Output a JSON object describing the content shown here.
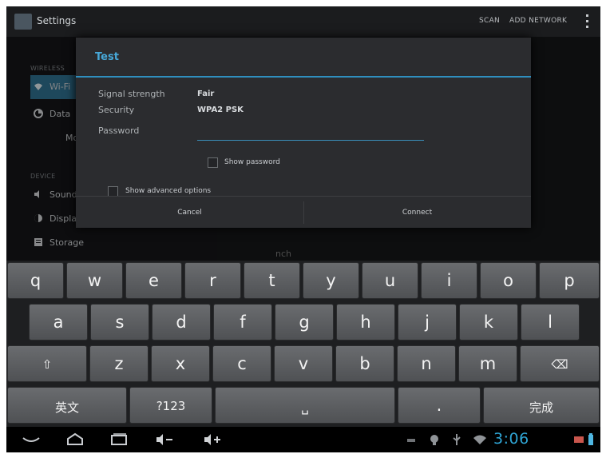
{
  "action_bar": {
    "title": "Settings",
    "actions": [
      "SCAN",
      "ADD NETWORK"
    ]
  },
  "settings_bg": {
    "categories": [
      "WIRELESS",
      "DEVICE"
    ],
    "items": [
      "Wi-Fi",
      "Data",
      "More",
      "Sound",
      "Display",
      "Storage"
    ],
    "right_fragment": "nch"
  },
  "dialog": {
    "title": "Test",
    "signal_label": "Signal strength",
    "signal_value": "Fair",
    "security_label": "Security",
    "security_value": "WPA2 PSK",
    "password_label": "Password",
    "password_value": "",
    "show_password": "Show password",
    "show_advanced": "Show advanced options",
    "cancel": "Cancel",
    "connect": "Connect"
  },
  "keyboard": {
    "row1": [
      "q",
      "w",
      "e",
      "r",
      "t",
      "y",
      "u",
      "i",
      "o",
      "p"
    ],
    "row2": [
      "a",
      "s",
      "d",
      "f",
      "g",
      "h",
      "j",
      "k",
      "l"
    ],
    "row3": [
      "⇧",
      "z",
      "x",
      "c",
      "v",
      "b",
      "n",
      "m",
      "⌫"
    ],
    "row4": [
      "英文",
      "?123",
      "␣",
      ".",
      "完成"
    ]
  },
  "nav_bar": {
    "clock": "3:06"
  },
  "colors": {
    "accent": "#47a8d8",
    "dialog_bg": "#2b2c2f",
    "key_bg": "#5e6063",
    "clock": "#2fa6d6"
  }
}
